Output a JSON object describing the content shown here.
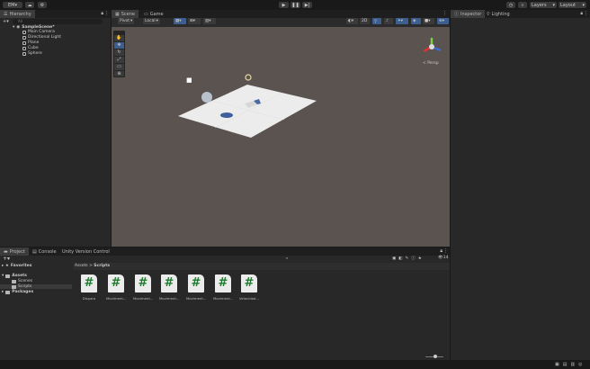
{
  "toolbar": {
    "account": "EM",
    "play_icon": "play-icon",
    "pause_icon": "pause-icon",
    "step_icon": "step-icon",
    "layers": "Layers",
    "layout": "Layout"
  },
  "hierarchy": {
    "tab": "Hierarchy",
    "search_placeholder": "All",
    "scene": "SampleScene*",
    "items": [
      "Main Camera",
      "Directional Light",
      "Plane",
      "Cube",
      "Sphere"
    ]
  },
  "scene": {
    "tabs": [
      "Scene",
      "Game"
    ],
    "pivot": "Pivot",
    "local": "Local",
    "mode_2d": "2D",
    "persp": "< Persp",
    "gizmo_axes": [
      "y",
      "x",
      "z"
    ]
  },
  "inspector": {
    "tabs": [
      "Inspector",
      "Lighting"
    ]
  },
  "project": {
    "tabs": [
      "Project",
      "Console",
      "Unity Version Control"
    ],
    "favorites": "Favorites",
    "assets": "Assets",
    "folders": [
      "Scenes",
      "Scripts"
    ],
    "packages": "Packages",
    "breadcrumb": [
      "Assets",
      "Scripts"
    ],
    "hidden_count": "14",
    "files": [
      "Dispara",
      "Moviment...",
      "Moviment...",
      "Moviment...",
      "Moviment...",
      "Moviment...",
      "Velocidad..."
    ],
    "file_icon": "#"
  },
  "colors": {
    "accent": "#3c5f8f",
    "viewport": "#5a5350",
    "plane": "#ececec",
    "script_icon": "#1e7b2e"
  }
}
